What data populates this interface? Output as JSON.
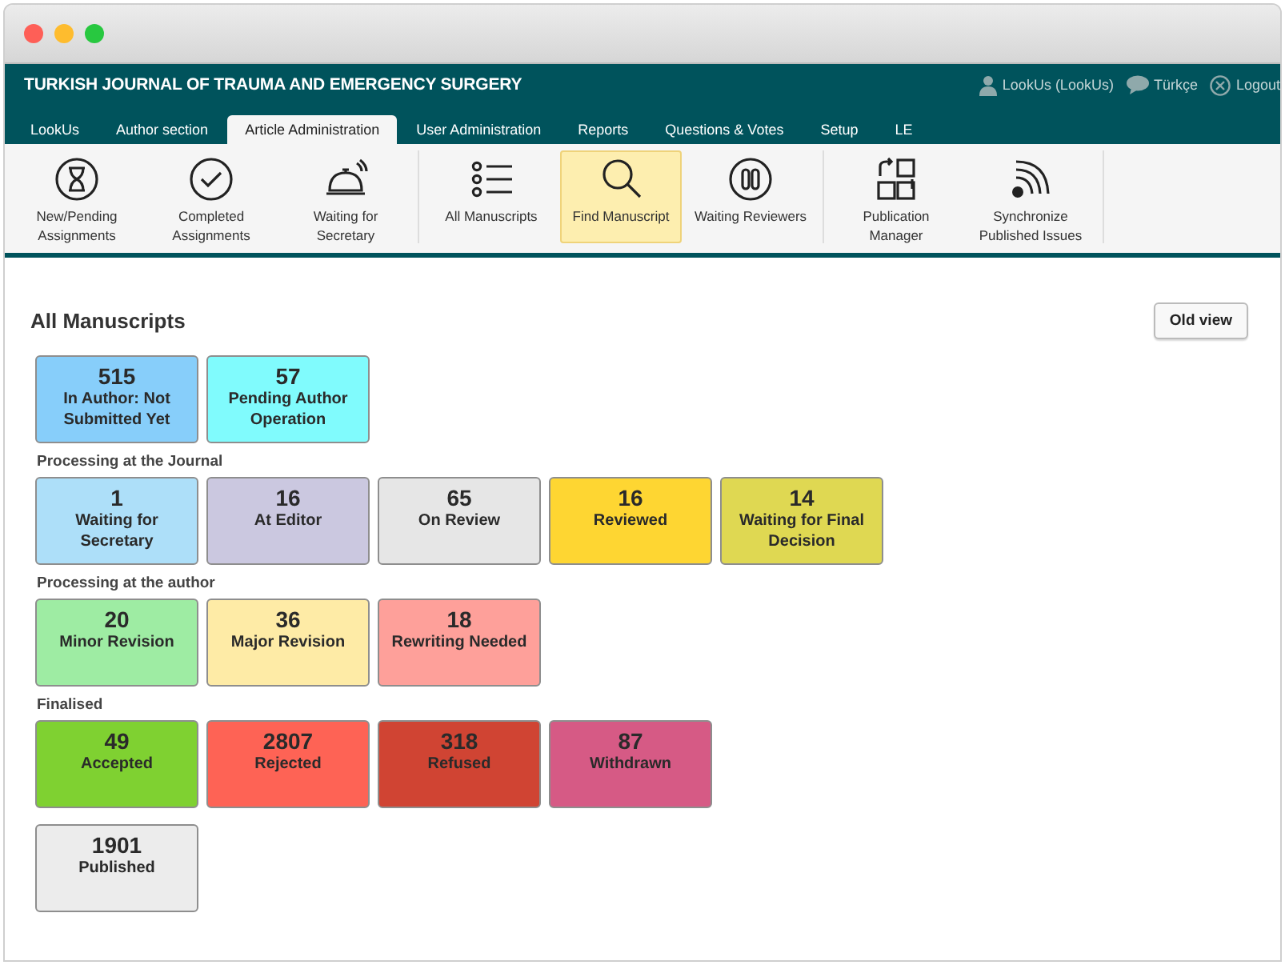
{
  "header": {
    "title": "TURKISH JOURNAL OF TRAUMA AND EMERGENCY SURGERY",
    "links": [
      {
        "kind": "user",
        "label": "LookUs (LookUs)"
      },
      {
        "kind": "language",
        "label": "Türkçe"
      },
      {
        "kind": "logout",
        "label": "Logout"
      }
    ]
  },
  "tabs": [
    {
      "label": "LookUs",
      "selected": false
    },
    {
      "label": "Author section",
      "selected": false
    },
    {
      "label": "Article Administration",
      "selected": true
    },
    {
      "label": "User Administration",
      "selected": false
    },
    {
      "label": "Reports",
      "selected": false
    },
    {
      "label": "Questions & Votes",
      "selected": false
    },
    {
      "label": "Setup",
      "selected": false
    },
    {
      "label": "LE",
      "selected": false
    }
  ],
  "toolbar": [
    [
      {
        "kind": "hourglass",
        "label": "New/Pending Assignments",
        "selected": false
      },
      {
        "kind": "check",
        "label": "Completed Assignments",
        "selected": false
      },
      {
        "kind": "bell",
        "label": "Waiting for Secretary",
        "selected": false
      }
    ],
    [
      {
        "kind": "list",
        "label": "All Manuscripts",
        "selected": false
      },
      {
        "kind": "search",
        "label": "Find Manuscript",
        "selected": true
      },
      {
        "kind": "pause",
        "label": "Waiting Reviewers",
        "selected": false
      }
    ],
    [
      {
        "kind": "squares",
        "label": "Publication Manager",
        "selected": false
      },
      {
        "kind": "feed",
        "label": "Synchronize Published Issues",
        "selected": false
      }
    ]
  ],
  "page": {
    "title": "All Manuscripts",
    "button": "Old view"
  },
  "groups": [
    {
      "tiles": [
        {
          "count": "515",
          "label": "In Author: Not Submitted Yet",
          "color": "#87cefa"
        },
        {
          "count": "57",
          "label": "Pending Author Operation",
          "color": "#80fbfd"
        }
      ]
    },
    {
      "heading": "Processing at the Journal",
      "tiles": [
        {
          "count": "1",
          "label": "Waiting for Secretary",
          "color": "#addff9"
        },
        {
          "count": "16",
          "label": "At Editor",
          "color": "#cbc8e0"
        },
        {
          "count": "65",
          "label": "On Review",
          "color": "#e6e6e6"
        },
        {
          "count": "16",
          "label": "Reviewed",
          "color": "#fed632"
        },
        {
          "count": "14",
          "label": "Waiting for Final Decision",
          "color": "#dfd852"
        }
      ]
    },
    {
      "heading": "Processing at the author",
      "tiles": [
        {
          "count": "20",
          "label": "Minor Revision",
          "color": "#9eeca3"
        },
        {
          "count": "36",
          "label": "Major Revision",
          "color": "#feeba6"
        },
        {
          "count": "18",
          "label": "Rewriting Needed",
          "color": "#fea09a"
        }
      ]
    },
    {
      "heading": "Finalised",
      "tiles": [
        {
          "count": "49",
          "label": "Accepted",
          "color": "#7fd131"
        },
        {
          "count": "2807",
          "label": "Rejected",
          "color": "#fe6355"
        },
        {
          "count": "318",
          "label": "Refused",
          "color": "#d04433"
        },
        {
          "count": "87",
          "label": "Withdrawn",
          "color": "#d65a85"
        }
      ]
    },
    {
      "tiles": [
        {
          "count": "1901",
          "label": "Published",
          "color": "#ececec"
        }
      ]
    }
  ]
}
